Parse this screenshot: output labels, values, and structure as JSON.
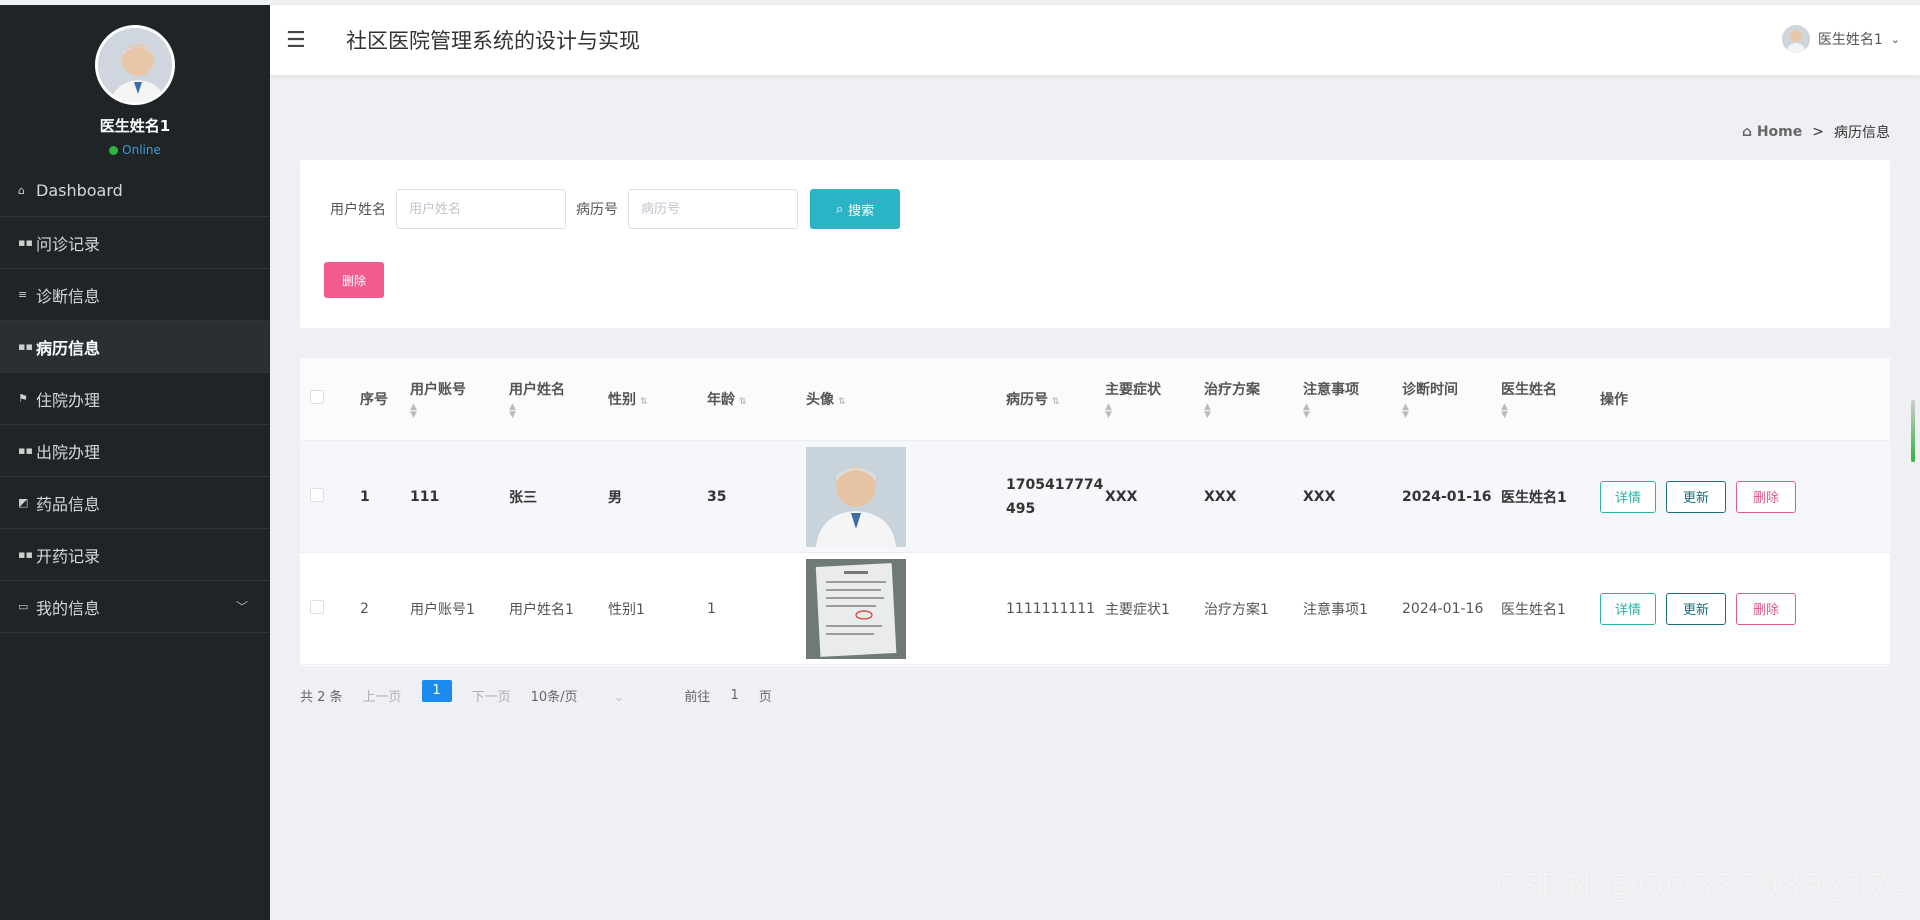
{
  "app": {
    "title": "社区医院管理系统的设计与实现"
  },
  "user": {
    "name": "医生姓名1",
    "status": "Online",
    "header_name": "医生姓名1"
  },
  "sidebar": {
    "items": [
      {
        "label": "Dashboard",
        "icon": "home-icon",
        "active": false
      },
      {
        "label": "问诊记录",
        "icon": "grid-icon",
        "active": false
      },
      {
        "label": "诊断信息",
        "icon": "list-icon",
        "active": false
      },
      {
        "label": "病历信息",
        "icon": "grid-icon",
        "active": true
      },
      {
        "label": "住院办理",
        "icon": "flag-icon",
        "active": false
      },
      {
        "label": "出院办理",
        "icon": "grid-icon",
        "active": false
      },
      {
        "label": "药品信息",
        "icon": "image-icon",
        "active": false
      },
      {
        "label": "开药记录",
        "icon": "grid-icon",
        "active": false
      },
      {
        "label": "我的信息",
        "icon": "card-icon",
        "active": false
      }
    ]
  },
  "breadcrumb": {
    "home": "Home",
    "separator": ">",
    "current": "病历信息"
  },
  "search": {
    "name_label": "用户姓名",
    "name_placeholder": "用户姓名",
    "record_label": "病历号",
    "record_placeholder": "病历号",
    "search_button": "搜索",
    "delete_button": "删除"
  },
  "table": {
    "headers": [
      "序号",
      "用户账号",
      "用户姓名",
      "性别",
      "年龄",
      "头像",
      "病历号",
      "主要症状",
      "治疗方案",
      "注意事项",
      "诊断时间",
      "医生姓名",
      "操作"
    ],
    "rows": [
      {
        "seq": "1",
        "account": "111",
        "name": "张三",
        "sex": "男",
        "age": "35",
        "record_no": "1705417774495",
        "symptom": "XXX",
        "plan": "XXX",
        "note": "XXX",
        "time": "2024-01-16",
        "doctor": "医生姓名1",
        "avatar": "doctor-photo"
      },
      {
        "seq": "2",
        "account": "用户账号1",
        "name": "用户姓名1",
        "sex": "性别1",
        "age": "1",
        "record_no": "1111111111",
        "symptom": "主要症状1",
        "plan": "治疗方案1",
        "note": "注意事项1",
        "time": "2024-01-16",
        "doctor": "医生姓名1",
        "avatar": "document-photo"
      }
    ],
    "actions": {
      "detail": "详情",
      "update": "更新",
      "delete": "删除"
    }
  },
  "pagination": {
    "total": "共 2 条",
    "prev": "上一页",
    "page": "1",
    "next": "下一页",
    "page_size": "10条/页",
    "goto": "前往",
    "goto_value": "1",
    "page_unit": "页"
  },
  "watermark": "CSDN @QQ3359892174",
  "colors": {
    "sidebar_bg": "#1f2427",
    "accent_search": "#2bb3c6",
    "delete_pink": "#f35b8f",
    "page_active": "#1c8bf0"
  }
}
